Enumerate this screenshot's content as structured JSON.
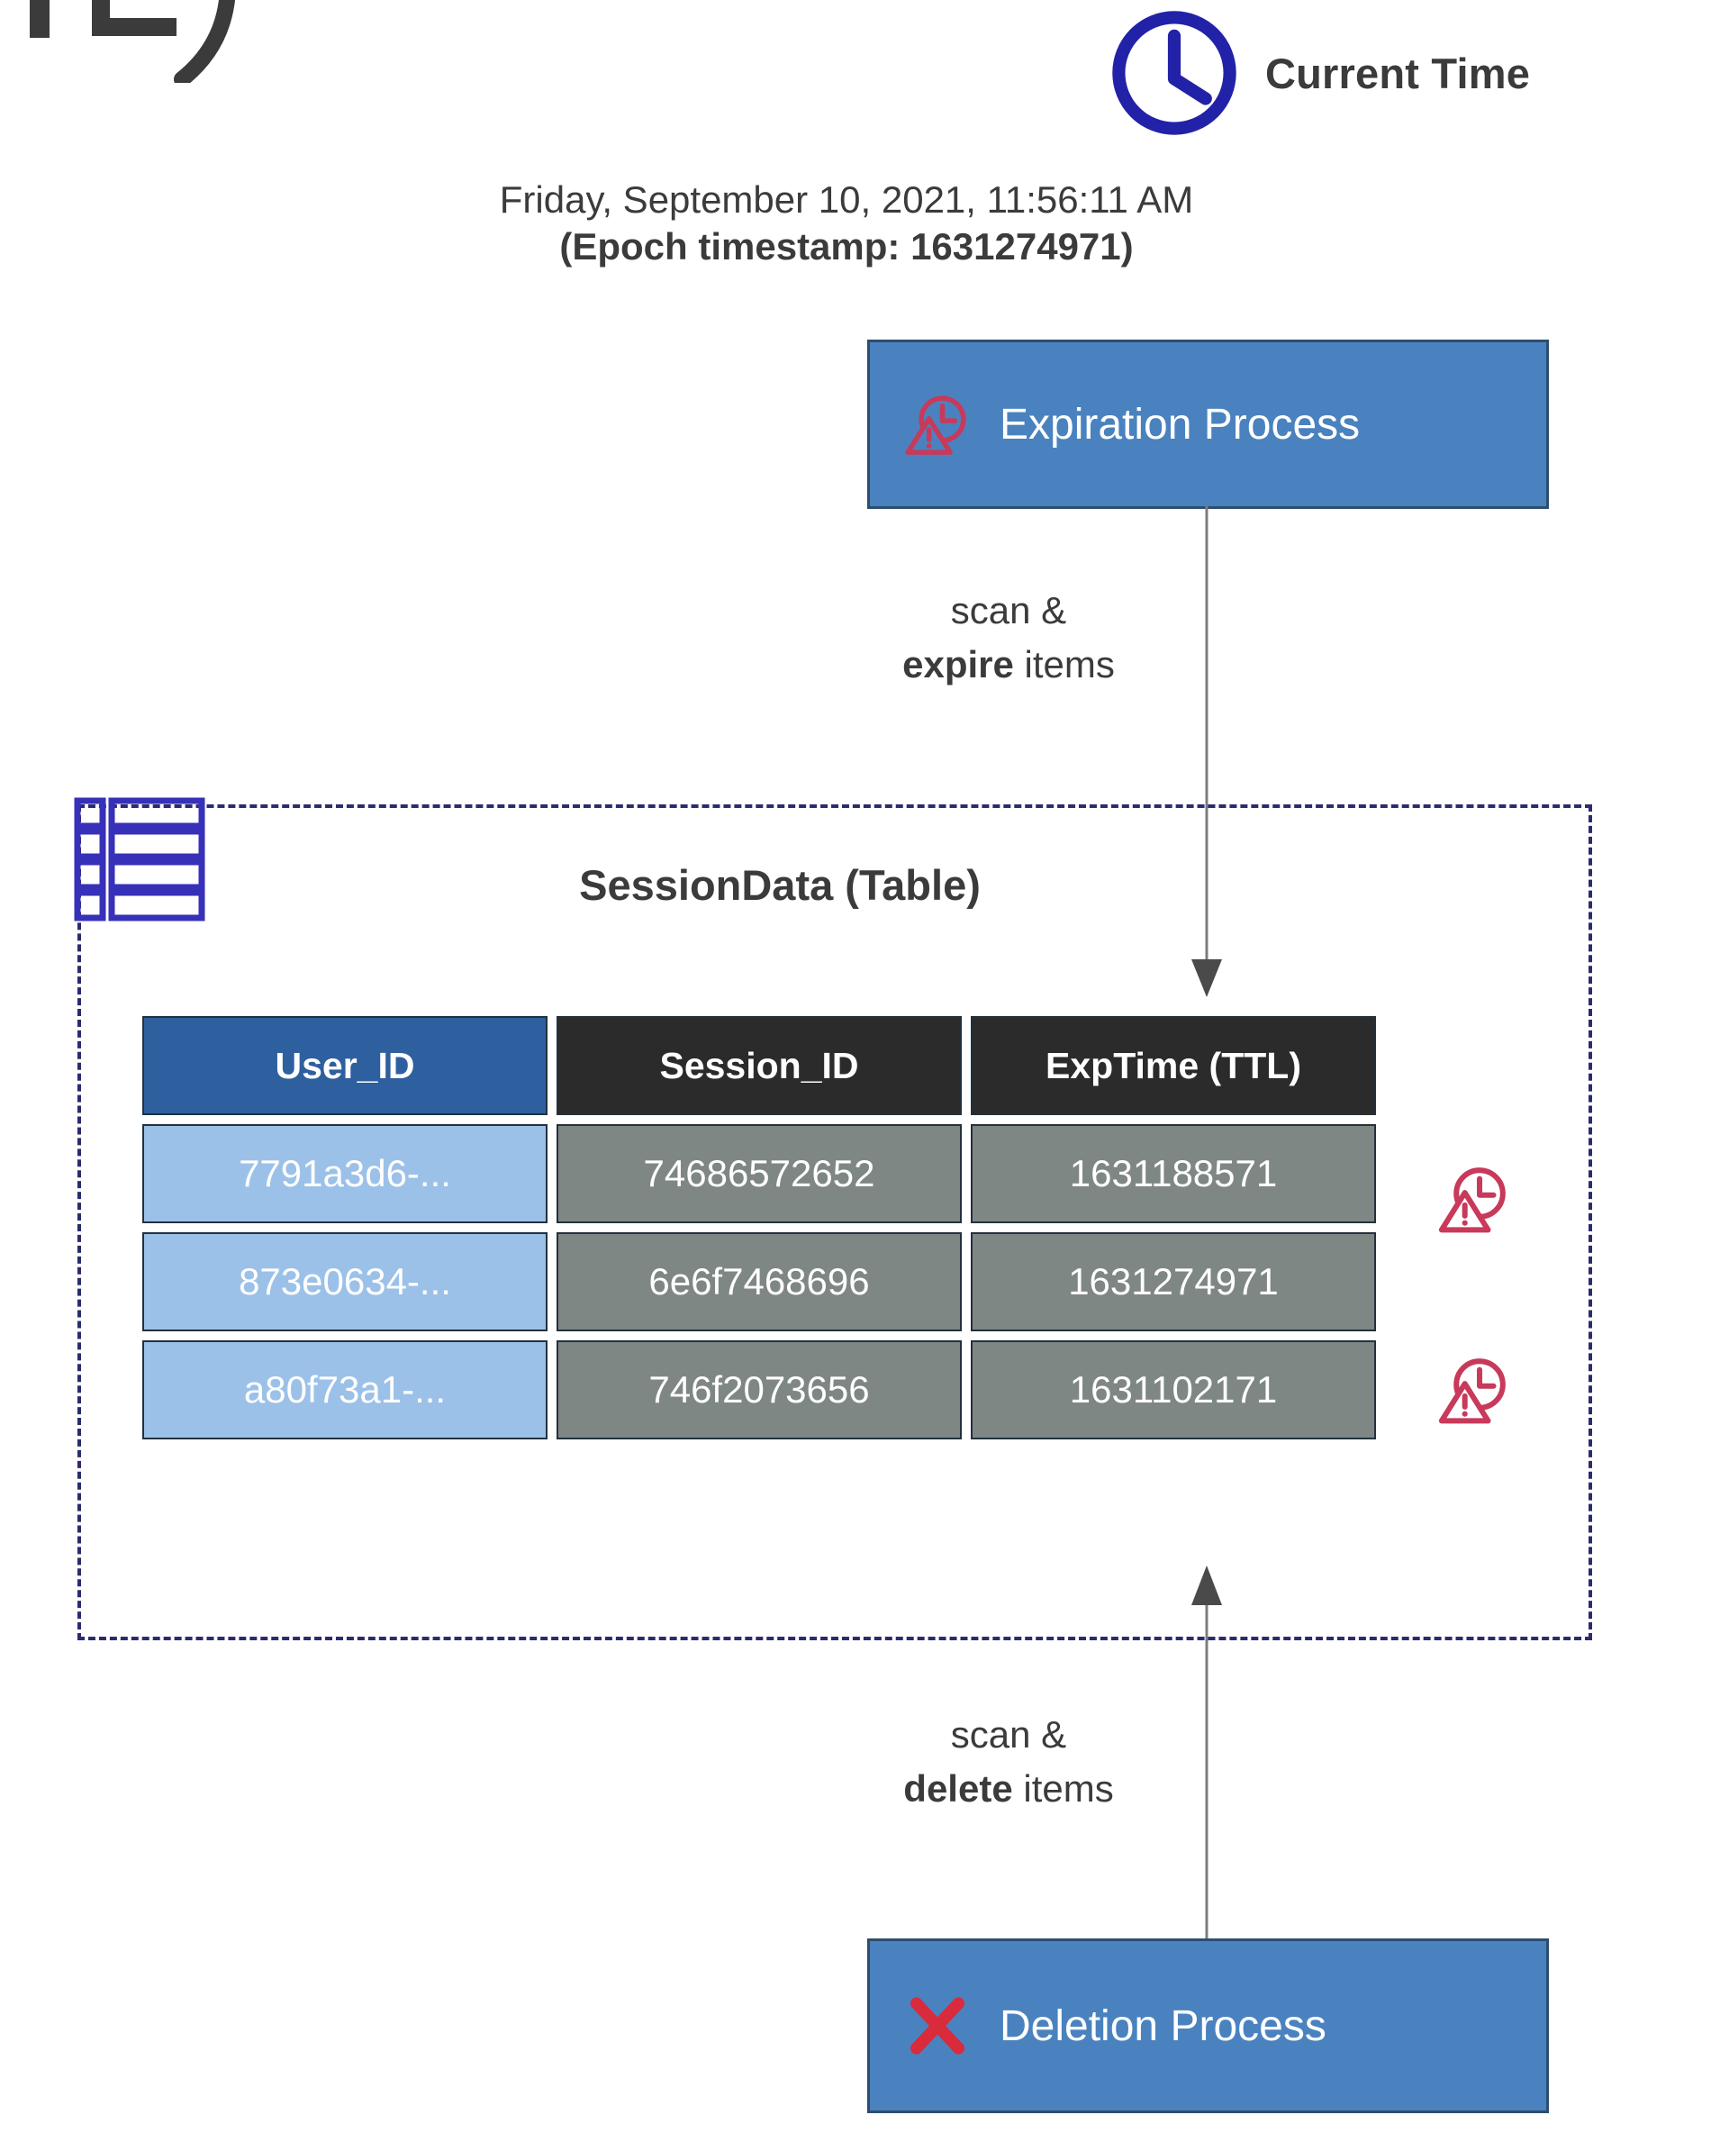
{
  "header": {
    "clock_icon": "clock-icon",
    "title": "Current Time",
    "datetime": "Friday, September 10, 2021, 11:56:11 AM",
    "epoch_line": "(Epoch timestamp: 1631274971)",
    "epoch_value": "1631274971",
    "clock_color": "#2222a8"
  },
  "processes": {
    "expiration": {
      "label": "Expiration Process",
      "icon": "clock-warning-icon",
      "box_color": "#4a82bf",
      "border_color": "#2e4d6e",
      "icon_color": "#c8395a"
    },
    "deletion": {
      "label": "Deletion Process",
      "icon": "red-x-icon",
      "box_color": "#4a82bf",
      "border_color": "#2e4d6e",
      "icon_color": "#d92b3c"
    }
  },
  "connectors": {
    "expire": {
      "line1": "scan &",
      "line2_strong": "expire",
      "line2_rest": " items",
      "direction": "down"
    },
    "delete": {
      "line1": "scan &",
      "line2_strong": "delete",
      "line2_rest": " items",
      "direction": "up"
    },
    "line_color": "#7d7d7d",
    "arrow_color": "#4a4a4a"
  },
  "table": {
    "icon": "table-icon",
    "icon_color": "#3730b8",
    "title": "SessionData (Table)",
    "container_border_color": "#2b2b6e",
    "columns": [
      {
        "key": "user_id",
        "label": "User_ID",
        "header_color": "#2e5f9e",
        "cell_color": "#9cc1e8"
      },
      {
        "key": "session_id",
        "label": "Session_ID",
        "header_color": "#2b2b2b",
        "cell_color": "#7f8785"
      },
      {
        "key": "exp_time",
        "label": "ExpTime (TTL)",
        "header_color": "#2b2b2b",
        "cell_color": "#7f8785"
      }
    ],
    "rows": [
      {
        "user_id": "7791a3d6-...",
        "session_id": "74686572652",
        "exp_time": "1631188571",
        "expired": true
      },
      {
        "user_id": "873e0634-...",
        "session_id": "6e6f7468696",
        "exp_time": "1631274971",
        "expired": false
      },
      {
        "user_id": "a80f73a1-...",
        "session_id": "746f2073656",
        "exp_time": "1631102171",
        "expired": true
      }
    ],
    "expired_marker_icon": "clock-warning-icon",
    "expired_marker_color": "#c8395a"
  }
}
